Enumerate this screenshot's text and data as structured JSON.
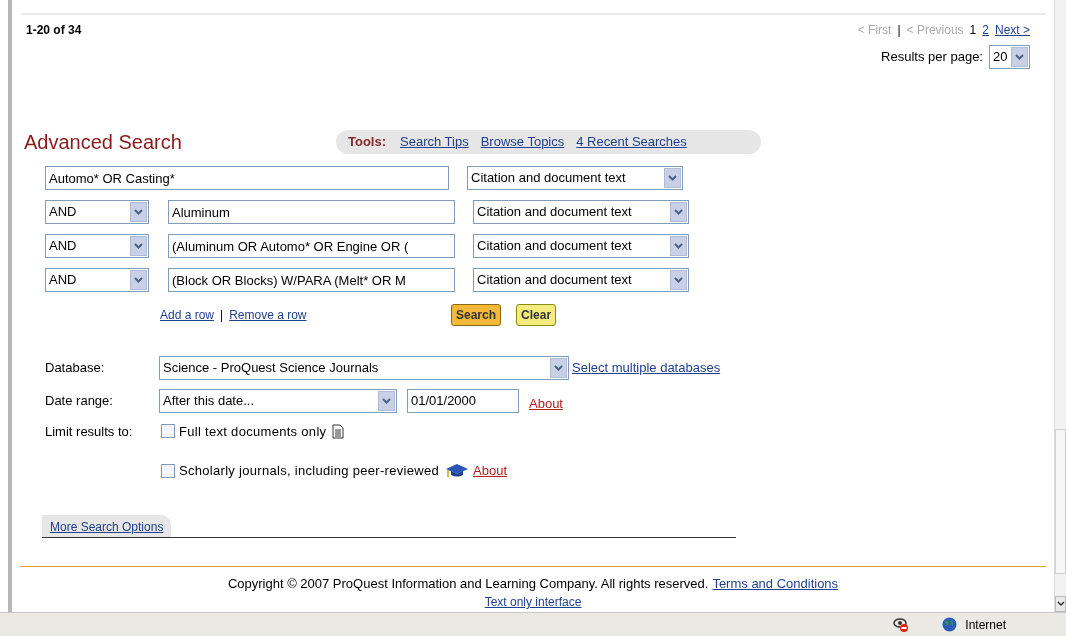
{
  "results": {
    "range": "1-20 of 34",
    "pager": [
      {
        "label": "< First",
        "kind": "disabled"
      },
      {
        "label": "|",
        "kind": "sep"
      },
      {
        "label": "< Previous",
        "kind": "disabled"
      },
      {
        "label": "1",
        "kind": "current"
      },
      {
        "label": "2",
        "kind": "link"
      },
      {
        "label": "Next >",
        "kind": "link"
      }
    ],
    "per_page_label": "Results per page:",
    "per_page": "20"
  },
  "search": {
    "title": "Advanced Search",
    "tools_label": "Tools:",
    "tools": [
      "Search Tips",
      "Browse Topics",
      "4 Recent Searches"
    ],
    "rows": [
      {
        "operator": null,
        "query": "Automo* OR Casting*",
        "field": "Citation and document text"
      },
      {
        "operator": "AND",
        "query": "Aluminum",
        "field": "Citation and document text"
      },
      {
        "operator": "AND",
        "query": "(Aluminum OR Automo* OR Engine OR (",
        "field": "Citation and document text"
      },
      {
        "operator": "AND",
        "query": "(Block OR Blocks) W/PARA (Melt* OR M",
        "field": "Citation and document text"
      }
    ],
    "row_links": [
      "Add a row",
      "|",
      "Remove a row"
    ],
    "search_button": "Search",
    "clear_button": "Clear",
    "database_label": "Database:",
    "database": "Science - ProQuest Science Journals",
    "database_link": "Select multiple databases",
    "date_label": "Date range:",
    "date_mode": "After this date...",
    "date": "01/01/2000",
    "date_about": "About",
    "limit_label": "Limit results to:",
    "limits": [
      {
        "label": "Full text documents only",
        "checked": false,
        "kind": "document"
      },
      {
        "label": "Scholarly journals, including peer-reviewed",
        "checked": false,
        "kind": "scholar",
        "about": "About"
      }
    ],
    "more_options": "More Search Options"
  },
  "footer": {
    "copyright": "Copyright © 2007 ProQuest Information and Learning Company. All rights reserved.",
    "terms": "Terms and Conditions",
    "text_only": "Text only interface"
  },
  "status_bar": {
    "zone": "Internet"
  }
}
